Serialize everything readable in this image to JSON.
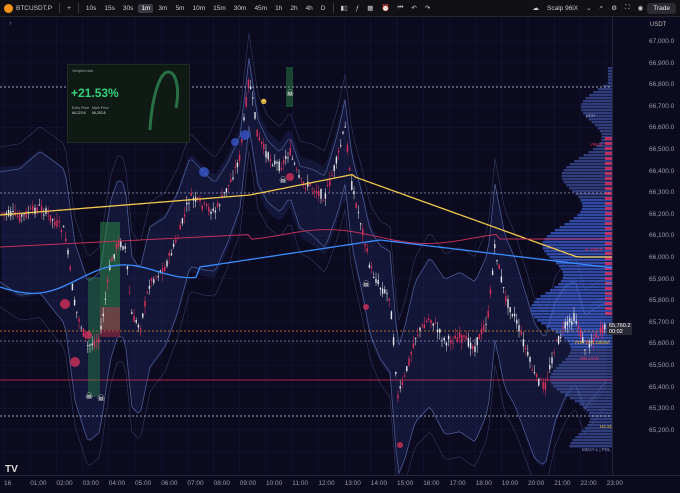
{
  "toolbar": {
    "symbol": "BTCUSDT.P",
    "plus": "+",
    "intervals": [
      "10s",
      "15s",
      "30s",
      "1m",
      "3m",
      "5m",
      "10m",
      "15m",
      "30m",
      "45m",
      "1h",
      "2h",
      "4h",
      "D"
    ],
    "active_interval": "1m",
    "layout_name": "Scalp 96iX",
    "trade_label": "Trade"
  },
  "price_axis": {
    "currency": "USDT",
    "ticks": [
      "67,000.0",
      "66,900.0",
      "66,800.0",
      "66,700.0",
      "66,600.0",
      "66,500.0",
      "66,400.0",
      "66,300.0",
      "66,200.0",
      "66,100.0",
      "66,000.0",
      "65,900.0",
      "65,800.0",
      "65,700.0",
      "65,600.0",
      "65,500.0",
      "65,400.0",
      "65,300.0",
      "65,200.0"
    ],
    "current_price": "65,760.2",
    "countdown": "00:02",
    "colors": {
      "current": "#2e2e3a",
      "hi": "#e8b923",
      "red": "#e0315e",
      "blue": "#3a8dff"
    }
  },
  "time_axis": {
    "ticks": [
      "16",
      "01:00",
      "02:00",
      "03:00",
      "04:00",
      "05:00",
      "06:00",
      "07:00",
      "08:00",
      "09:00",
      "10:00",
      "11:00",
      "12:00",
      "13:00",
      "14:00",
      "15:00",
      "16:00",
      "17:00",
      "18:00",
      "19:00",
      "20:00",
      "21:00",
      "22:00",
      "23:00"
    ]
  },
  "chart_labels": {
    "pdh": "pDH",
    "vwap": "VWAP",
    "h4_100ema": "H4 100EMA",
    "d_vwap": "D-VWAP",
    "pdh_h4_12ema": "PDH | H4 12EMA",
    "md_low": "MD-LOW",
    "h4_21ema": "H4 21EMA",
    "mday": "MDAY-L | PDL",
    "pane_index": "7"
  },
  "pnl_card": {
    "header": "Veriphiorian",
    "pct": "+21.53%",
    "entry_label": "Entry Price",
    "entry_value": "66,223.6",
    "mark_label": "Mark Price",
    "mark_value": "66,253.8"
  },
  "logo": "TV"
}
